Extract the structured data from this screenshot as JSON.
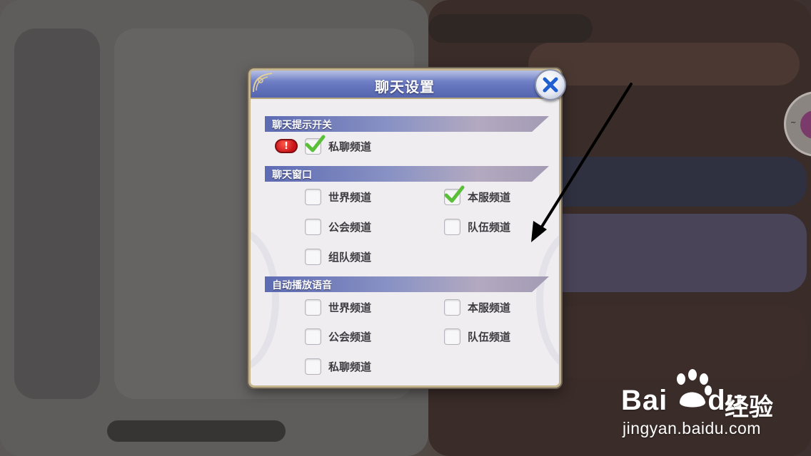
{
  "dialog": {
    "title": "聊天设置",
    "close_icon": "close-icon"
  },
  "sections": [
    {
      "title": "聊天提示开关",
      "options": [
        {
          "label": "私聊频道",
          "checked": true
        }
      ]
    },
    {
      "title": "聊天窗口",
      "options": [
        {
          "label": "世界频道",
          "checked": false
        },
        {
          "label": "本服频道",
          "checked": true
        },
        {
          "label": "公会频道",
          "checked": false
        },
        {
          "label": "队伍频道",
          "checked": false
        },
        {
          "label": "组队频道",
          "checked": false
        }
      ]
    },
    {
      "title": "自动播放语音",
      "options": [
        {
          "label": "世界频道",
          "checked": false
        },
        {
          "label": "本服频道",
          "checked": false
        },
        {
          "label": "公会频道",
          "checked": false
        },
        {
          "label": "队伍频道",
          "checked": false
        },
        {
          "label": "私聊频道",
          "checked": false
        }
      ]
    }
  ],
  "alert_badge": "!",
  "colors": {
    "title_bar": "#6676bf",
    "check_green": "#5cbf3a",
    "alert_red": "#d8151d"
  },
  "watermark": {
    "logo_text": "Bai",
    "logo_text_2": "du",
    "cn_text": "经验",
    "url": "jingyan.baidu.com"
  }
}
